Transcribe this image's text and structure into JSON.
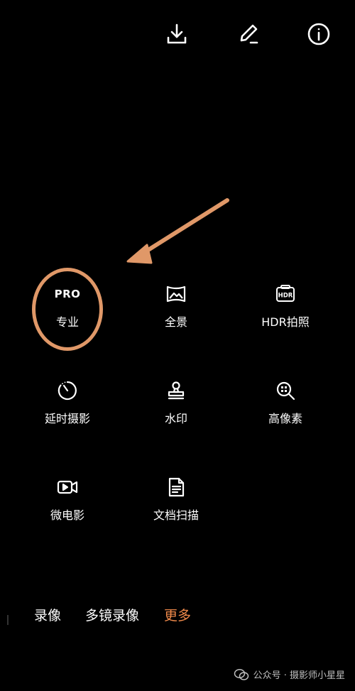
{
  "toolbar": {
    "download_icon": "download-icon",
    "edit_icon": "pen-icon",
    "info_icon": "info-icon"
  },
  "modes": [
    {
      "id": "pro",
      "icon_text": "PRO",
      "label": "专业"
    },
    {
      "id": "panorama",
      "icon": "panorama-icon",
      "label": "全景"
    },
    {
      "id": "hdr",
      "icon_text": "HDR",
      "label": "HDR拍照"
    },
    {
      "id": "timelapse",
      "icon": "timer-icon",
      "label": "延时摄影"
    },
    {
      "id": "watermark",
      "icon": "stamp-icon",
      "label": "水印"
    },
    {
      "id": "highres",
      "icon": "high-res-icon",
      "label": "高像素"
    },
    {
      "id": "movie",
      "icon": "video-icon",
      "label": "微电影"
    },
    {
      "id": "docscan",
      "icon": "document-icon",
      "label": "文档扫描"
    }
  ],
  "tabs": [
    {
      "label": "录像",
      "active": false
    },
    {
      "label": "多镜录像",
      "active": false
    },
    {
      "label": "更多",
      "active": true
    }
  ],
  "colors": {
    "annotation": "#e09868",
    "active_tab": "#f08a4b",
    "background": "#000000"
  },
  "watermark": {
    "text": "公众号 · 摄影师小星星"
  }
}
